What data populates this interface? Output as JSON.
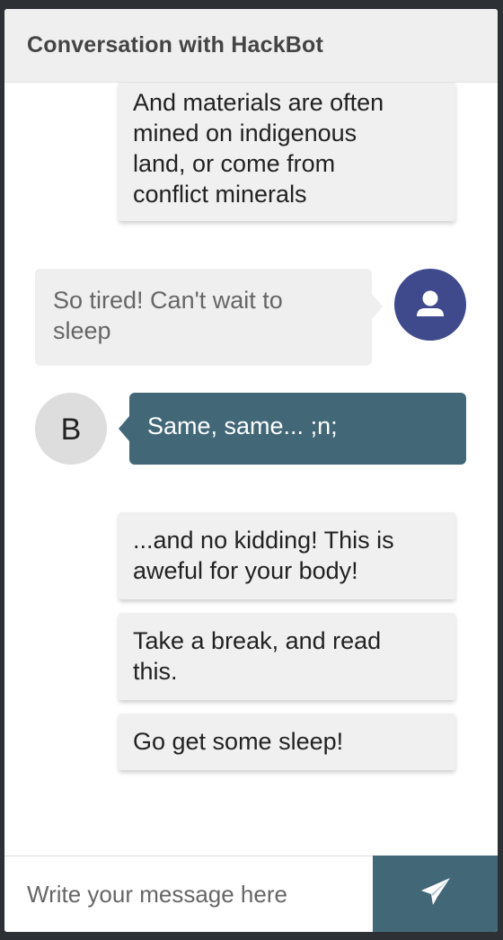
{
  "header": {
    "title": "Conversation with HackBot"
  },
  "messages": {
    "bot_card_1": [
      "And materials are often",
      "mined on indigenous",
      "land, or come from",
      "conflict minerals"
    ],
    "user_message": {
      "line1": "So tired! Can't wait to",
      "line2": "sleep"
    },
    "bot_avatar_letter": "B",
    "bot_message": "Same, same... ;n;",
    "bot_card_2": [
      "...and no kidding! This is",
      "aweful for your body!"
    ],
    "bot_card_3": [
      "Take a break, and read",
      "this."
    ],
    "bot_card_4": [
      "Go get some sleep!"
    ]
  },
  "composer": {
    "placeholder": "Write your message here",
    "value": ""
  },
  "icons": {
    "user_avatar": "user-icon",
    "send": "paper-plane-icon"
  },
  "colors": {
    "user_avatar_bg": "#3e4a8c",
    "bot_bubble_bg": "#426878",
    "send_button_bg": "#426878"
  }
}
